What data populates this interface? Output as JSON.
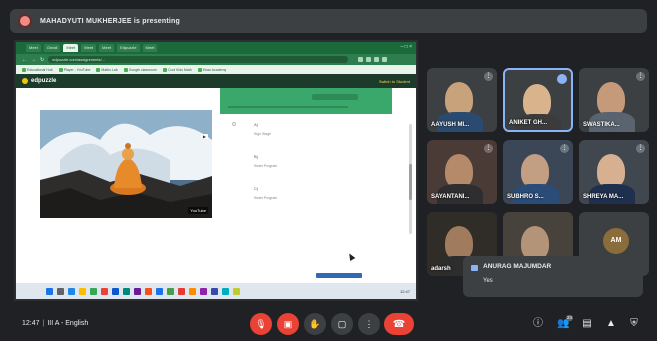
{
  "banner": {
    "text": "MAHADYUTI MUKHERJEE is presenting",
    "icon": "present-icon"
  },
  "browser": {
    "tabs": [
      "Meet",
      "Gmail",
      "Meet",
      "Meet",
      "Meet",
      "Edpuzzle",
      "Meet"
    ],
    "active_tab": 2,
    "url": "edpuzzle.com/assignments/...",
    "bookmarks": [
      "Educational Hub",
      "Player - YouTube",
      "Maths Lab",
      "Google classroom",
      "Cool Kids Math",
      "Khan Academy"
    ],
    "site_name": "edpuzzle",
    "top_right_link": "Switch to Student",
    "video_badge": "YouTube",
    "options": [
      {
        "key": "A)",
        "value": "Sign Stage"
      },
      {
        "key": "B)",
        "value": "Sister Program"
      },
      {
        "key": "C)",
        "value": "Sister Program"
      }
    ],
    "tray_time": "12:47"
  },
  "participants": [
    {
      "name": "AAYUSH MI...",
      "face": "#c8a27a",
      "body": "#2b4a70",
      "bg": "#5b6168"
    },
    {
      "name": "ANIKET GH...",
      "face": "#d9b38c",
      "body": "#3b3b3b",
      "bg": "#7a7f88",
      "active": true
    },
    {
      "name": "SWASTIKA...",
      "face": "#c49a7a",
      "body": "#5a6470",
      "bg": "#6d7077"
    },
    {
      "name": "SAYANTANI...",
      "face": "#b48a6a",
      "body": "#2e2e30",
      "bg": "#4b3b36"
    },
    {
      "name": "SUBHRO S...",
      "face": "#c29e82",
      "body": "#2a4c78",
      "bg": "#3b4756"
    },
    {
      "name": "SHREYA MA...",
      "face": "#d6b090",
      "body": "#1f2f4e",
      "bg": "#40474f"
    },
    {
      "name": "adarsh",
      "face": "#a07b5d",
      "body": "#2d2d2d",
      "bg": "#302c28"
    },
    {
      "name": "",
      "face": "#b39478",
      "body": "#3a3a3a",
      "bg": "#48423c"
    },
    {
      "name": "",
      "avatar": "AM",
      "bg": "#3c4043"
    }
  ],
  "chat": {
    "sender": "ANURAG MAJUMDAR",
    "message": "Yes"
  },
  "bottombar": {
    "time": "12:47",
    "meeting": "III A - English",
    "controls": [
      "mic-off-icon",
      "camera-off-icon",
      "raise-hand-icon",
      "present-icon",
      "more-options-icon"
    ],
    "end_call": "end-call-icon",
    "right_icons": [
      "info-icon",
      "people-icon",
      "chat-icon",
      "activities-icon",
      "host-controls-icon"
    ],
    "people_count": "24"
  }
}
